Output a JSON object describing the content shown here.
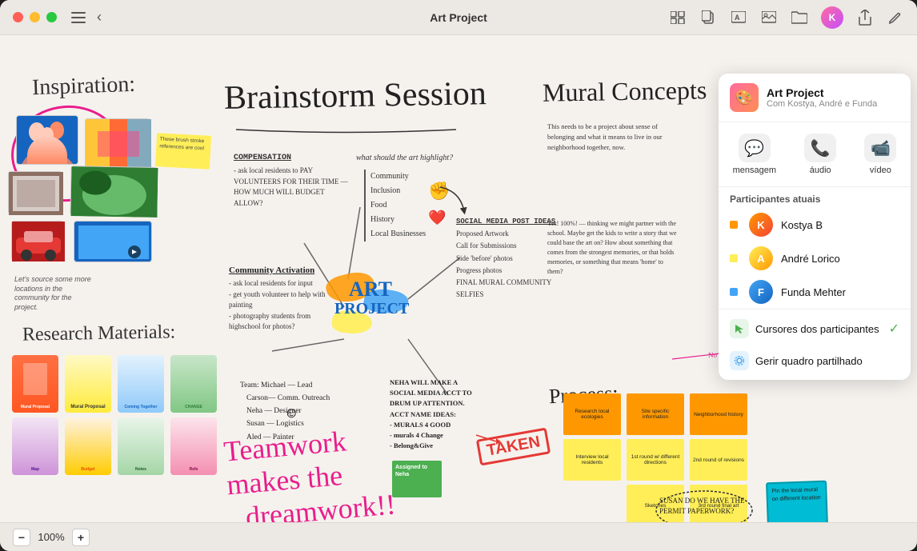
{
  "window": {
    "title": "Art Project",
    "zoom": "100%"
  },
  "titlebar": {
    "back_icon": "‹",
    "title": "Art Project",
    "share_icon": "↑",
    "edit_icon": "✎"
  },
  "canvas": {
    "inspiration_label": "Inspiration:",
    "brainstorm_title": "Brainstorm Session",
    "mural_concepts_title": "Mural Concepts",
    "research_label": "Research Materials:",
    "teamwork_text": "Teamwork makes the dreamwork!!",
    "art_project_art": "ART",
    "art_project_project": "PROJECT",
    "taken_text": "TAKEN",
    "process_label": "Process:",
    "brush_note": "These brush stroke references are cool",
    "source_text": "Let's source some more locations in the community for the project.",
    "compensation_title": "COMPENSATION",
    "compensation_body": "- ask local residents to pay volunteers for their time — how much will budget allow?",
    "community_activation_title": "Community Activation",
    "community_activation_body": "- ask local residents for input\n- get youth volunteer to help with painting\n- photography students from highschool for photos?",
    "team_block": "Team: Michael - Lead\nCarson - Comm. Outreach\nNeha - Designer\nSusan - Logistics\nAled - Painter",
    "highlight_question": "what should the art highlight?",
    "checklist_items": [
      "Community",
      "Inclusion",
      "Food",
      "History",
      "Local Businesses"
    ],
    "social_media_title": "SOCIAL MEDIA POST IDEAS",
    "social_media_items": [
      "Proposed Artwork",
      "Call for Submissions",
      "Side 'before' photos",
      "Progress photos",
      "FINAL MURAL COMMUNITY SELFIES"
    ],
    "neha_block": "NEHA WILL MAKE A\nSOCIAL MEDIA ACCT TO\nDRUM UP ATTENTION.\nACCT NAME IDEAS:\n- MURALS 4 GOOD\n- murals 4 Change\n- Belong&Give",
    "assigned_label": "Assigned to Neha",
    "mural_paragraph": "This needs to be a project about sense of belonging and what it means to live in our neighborhood together, now.",
    "yes_block": "Yes! 100%! — thinking we might partner with the school. Maybe get the kids to write a story that we could base the art on? How about something that comes from the strongest memories, or that holds memories, or something that means 'home' to them?",
    "dimensions_note": "No definite dimensions. Best",
    "susan_note": "SUSAN DO WE HAVE THE PERMIT PAPERWORK?",
    "cyan_sticky": "Pin the local mural on different location",
    "pink_arrow_text": "← No definite / dimensions. Best",
    "postits": [
      {
        "label": "Research local ecologies",
        "color": "orange"
      },
      {
        "label": "Site specific information",
        "color": "orange"
      },
      {
        "label": "Neighborhood history",
        "color": "orange"
      },
      {
        "label": "1st round w/ different directions",
        "color": "yellow"
      },
      {
        "label": "2nd round of revisions",
        "color": "yellow"
      },
      {
        "label": "3rd round final art",
        "color": "yellow"
      },
      {
        "label": "Interview local residents",
        "color": "orange"
      },
      {
        "label": "Sketches",
        "color": "yellow"
      }
    ]
  },
  "collab_panel": {
    "title": "Art Project",
    "subtitle": "Com Kostya, André e Funda",
    "actions": [
      {
        "icon": "💬",
        "label": "mensagem"
      },
      {
        "icon": "📞",
        "label": "áudio"
      },
      {
        "icon": "📹",
        "label": "vídeo"
      }
    ],
    "participants_header": "Participantes atuais",
    "participants": [
      {
        "name": "Kostya B",
        "color": "orange"
      },
      {
        "name": "André Lorico",
        "color": "yellow"
      },
      {
        "name": "Funda Mehter",
        "color": "blue"
      }
    ],
    "options": [
      {
        "icon": "✓",
        "label": "Cursores dos participantes",
        "checked": true
      },
      {
        "icon": "⚙",
        "label": "Gerir quadro partilhado",
        "checked": false
      }
    ]
  },
  "toolbar": {
    "zoom_minus": "−",
    "zoom_level": "100%",
    "zoom_plus": "+"
  }
}
